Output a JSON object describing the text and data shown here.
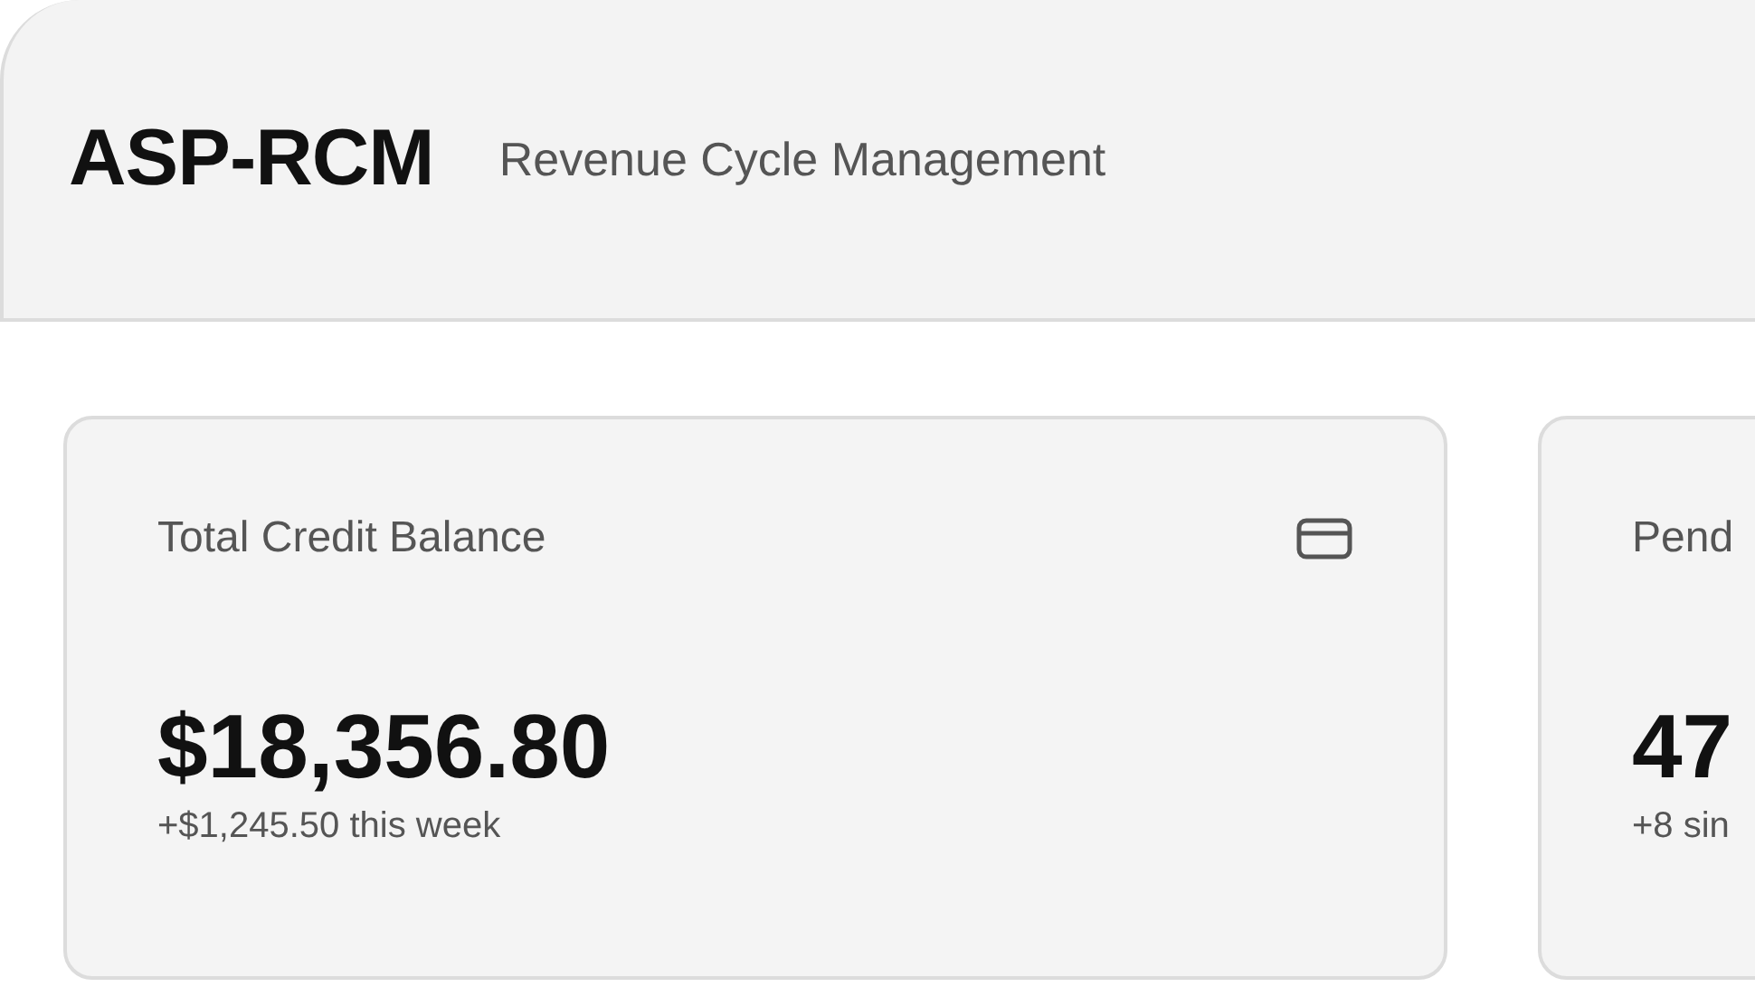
{
  "header": {
    "title": "ASP-RCM",
    "subtitle": "Revenue Cycle Management"
  },
  "cards": [
    {
      "label": "Total Credit Balance",
      "value": "$18,356.80",
      "change": "+$1,245.50 this week",
      "icon": true
    },
    {
      "label": "Pend",
      "value": "47",
      "change": "+8 sin"
    }
  ]
}
